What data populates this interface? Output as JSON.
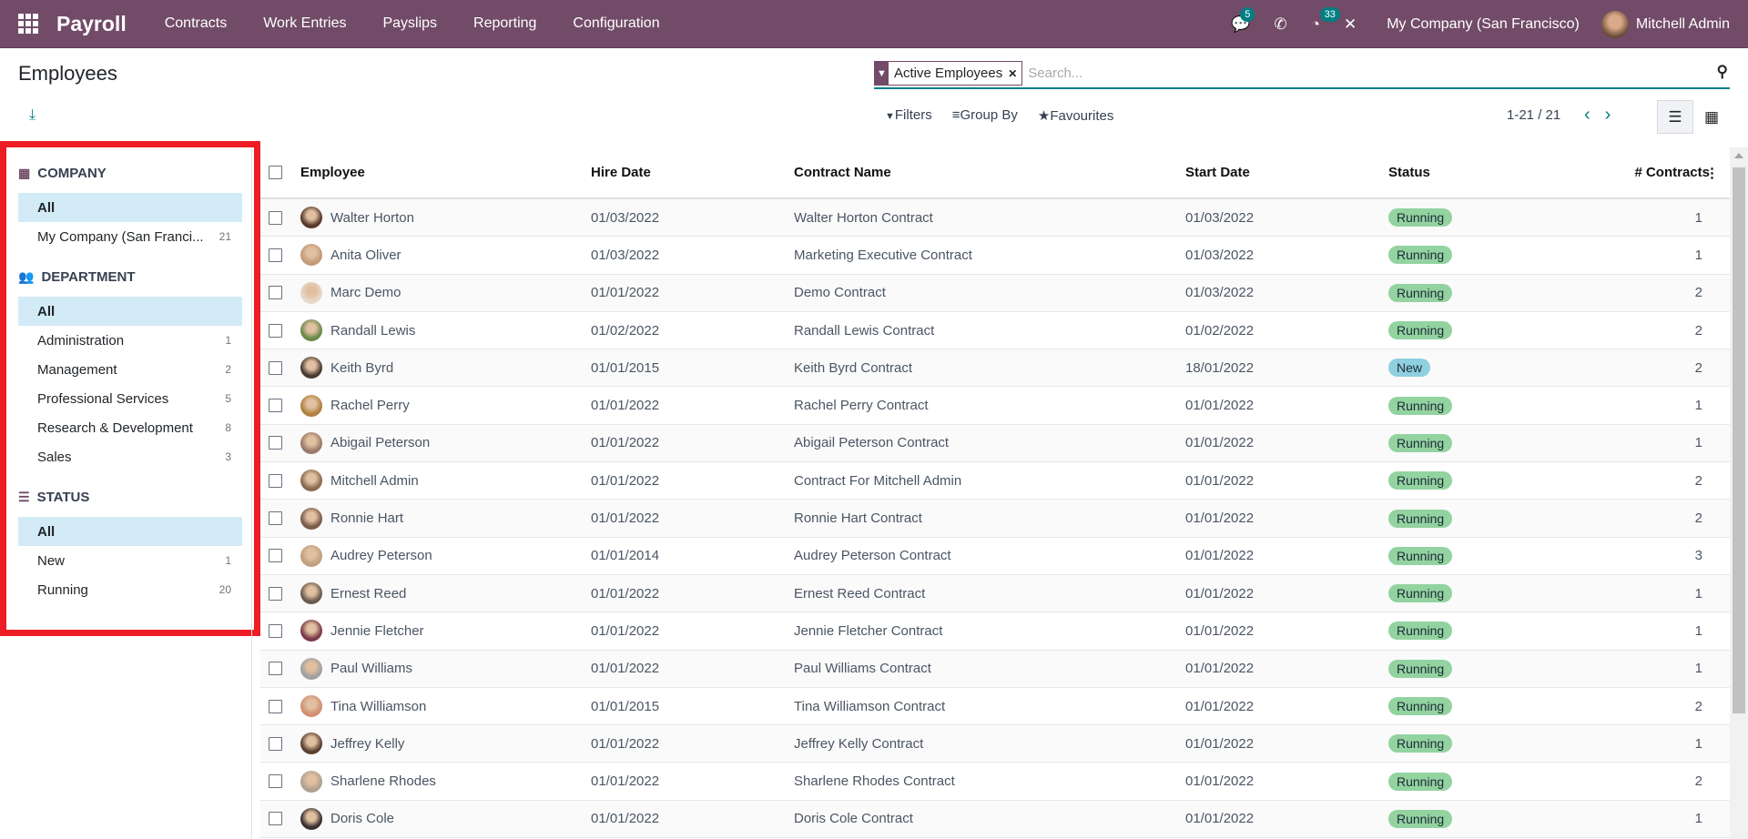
{
  "nav": {
    "brand": "Payroll",
    "menu": [
      "Contracts",
      "Work Entries",
      "Payslips",
      "Reporting",
      "Configuration"
    ],
    "chat_badge": "5",
    "activity_badge": "33",
    "company": "My Company (San Francisco)",
    "user": "Mitchell Admin",
    "color": "#714B67"
  },
  "page": {
    "title": "Employees"
  },
  "search": {
    "facet": "Active Employees",
    "placeholder": "Search..."
  },
  "options": {
    "filters": "Filters",
    "group_by": "Group By",
    "favourites": "Favourites"
  },
  "pager": {
    "value": "1-21 / 21"
  },
  "sidebar": {
    "sections": [
      {
        "title": "COMPANY",
        "icon": "building-icon",
        "items": [
          {
            "label": "All",
            "selected": true
          },
          {
            "label": "My Company (San Franci...",
            "count": "21"
          }
        ]
      },
      {
        "title": "DEPARTMENT",
        "icon": "users-icon",
        "items": [
          {
            "label": "All",
            "selected": true
          },
          {
            "label": "Administration",
            "count": "1"
          },
          {
            "label": "Management",
            "count": "2"
          },
          {
            "label": "Professional Services",
            "count": "5"
          },
          {
            "label": "Research & Development",
            "count": "8"
          },
          {
            "label": "Sales",
            "count": "3"
          }
        ]
      },
      {
        "title": "STATUS",
        "icon": "tasks-icon",
        "items": [
          {
            "label": "All",
            "selected": true
          },
          {
            "label": "New",
            "count": "1"
          },
          {
            "label": "Running",
            "count": "20"
          }
        ]
      }
    ]
  },
  "table": {
    "columns": [
      "Employee",
      "Hire Date",
      "Contract Name",
      "Start Date",
      "Status",
      "# Contracts"
    ],
    "rows": [
      [
        "Walter Horton",
        "01/03/2022",
        "Walter Horton Contract",
        "01/03/2022",
        "Running",
        "1"
      ],
      [
        "Anita Oliver",
        "01/03/2022",
        "Marketing Executive Contract",
        "01/03/2022",
        "Running",
        "1"
      ],
      [
        "Marc Demo",
        "01/01/2022",
        "Demo Contract",
        "01/03/2022",
        "Running",
        "2"
      ],
      [
        "Randall Lewis",
        "01/02/2022",
        "Randall Lewis Contract",
        "01/02/2022",
        "Running",
        "2"
      ],
      [
        "Keith Byrd",
        "01/01/2015",
        "Keith Byrd Contract",
        "18/01/2022",
        "New",
        "2"
      ],
      [
        "Rachel Perry",
        "01/01/2022",
        "Rachel Perry Contract",
        "01/01/2022",
        "Running",
        "1"
      ],
      [
        "Abigail Peterson",
        "01/01/2022",
        "Abigail Peterson Contract",
        "01/01/2022",
        "Running",
        "1"
      ],
      [
        "Mitchell Admin",
        "01/01/2022",
        "Contract For Mitchell Admin",
        "01/01/2022",
        "Running",
        "2"
      ],
      [
        "Ronnie Hart",
        "01/01/2022",
        "Ronnie Hart Contract",
        "01/01/2022",
        "Running",
        "2"
      ],
      [
        "Audrey Peterson",
        "01/01/2014",
        "Audrey Peterson Contract",
        "01/01/2022",
        "Running",
        "3"
      ],
      [
        "Ernest Reed",
        "01/01/2022",
        "Ernest Reed Contract",
        "01/01/2022",
        "Running",
        "1"
      ],
      [
        "Jennie Fletcher",
        "01/01/2022",
        "Jennie Fletcher Contract",
        "01/01/2022",
        "Running",
        "1"
      ],
      [
        "Paul Williams",
        "01/01/2022",
        "Paul Williams Contract",
        "01/01/2022",
        "Running",
        "1"
      ],
      [
        "Tina Williamson",
        "01/01/2015",
        "Tina Williamson Contract",
        "01/01/2022",
        "Running",
        "2"
      ],
      [
        "Jeffrey Kelly",
        "01/01/2022",
        "Jeffrey Kelly Contract",
        "01/01/2022",
        "Running",
        "1"
      ],
      [
        "Sharlene Rhodes",
        "01/01/2022",
        "Sharlene Rhodes Contract",
        "01/01/2022",
        "Running",
        "2"
      ],
      [
        "Doris Cole",
        "01/01/2022",
        "Doris Cole Contract",
        "01/01/2022",
        "Running",
        "1"
      ]
    ]
  },
  "status_colors": {
    "Running": "#92d3a0",
    "New": "#8ed0e0"
  },
  "highlight_color": "#ee1c25"
}
